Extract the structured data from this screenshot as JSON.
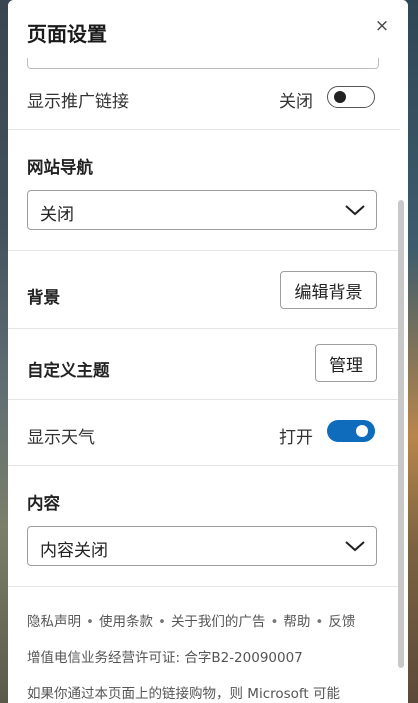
{
  "panel": {
    "title": "页面设置",
    "close_icon": "×"
  },
  "promo_links": {
    "label": "显示推广链接",
    "toggle_state_text": "关闭",
    "enabled": false
  },
  "site_navigation": {
    "title": "网站导航",
    "selected": "关闭"
  },
  "background": {
    "title": "背景",
    "button_label": "编辑背景"
  },
  "custom_theme": {
    "title": "自定义主题",
    "button_label": "管理"
  },
  "weather": {
    "label": "显示天气",
    "toggle_state_text": "打开",
    "enabled": true,
    "accent_color": "#0f6cbd"
  },
  "content": {
    "title": "内容",
    "selected": "内容关闭"
  },
  "footer": {
    "links": [
      "隐私声明",
      "使用条款",
      "关于我们的广告",
      "帮助",
      "反馈"
    ],
    "separator": "•",
    "license": "增值电信业务经营许可证: 合字B2-20090007",
    "disclaimer": "如果你通过本页面上的链接购物，则 Microsoft 可能"
  }
}
